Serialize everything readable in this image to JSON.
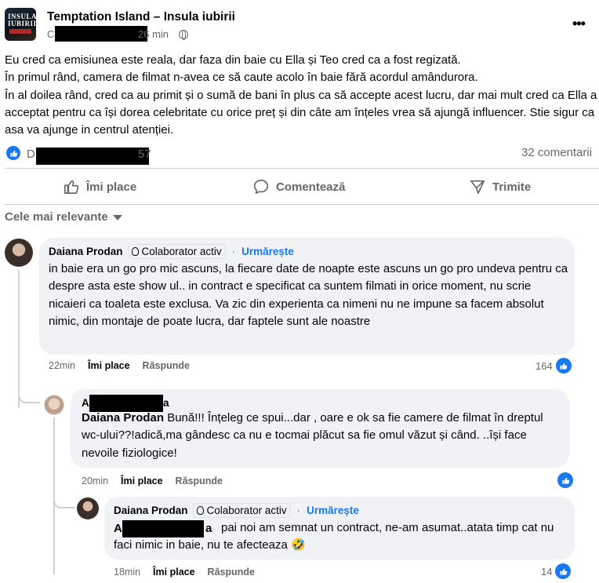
{
  "post": {
    "group_name": "Temptation Island – Insula iubirii",
    "group_logo_text": "INSULA IUBIRII",
    "author_partial": "Ch",
    "time_suffix": "26 min",
    "body": "Eu cred ca emisiunea este reala, dar faza din baie cu Ella și Teo cred ca a fost regizată.\nÎn primul rând, camera de filmat n-avea ce să caute acolo în baie fără acordul amândurora.\nÎn al doilea rând, cred ca au primit și o sumă de bani în plus ca să accepte acest lucru, dar mai mult cred ca Ella a acceptat pentru ca își dorea celebritate cu orice preț și din câte am înțeles vrea să ajungă influencer. Stie sigur ca asa va ajunge in centrul atenției.",
    "reactions_prefix": "D",
    "reactions_suffix": "57",
    "comments_count": "32 comentarii"
  },
  "actions": {
    "like": "Îmi place",
    "comment": "Comentează",
    "share": "Trimite"
  },
  "sort_label": "Cele mai relevante",
  "comments": [
    {
      "author": "Daiana Prodan",
      "badge": "Colaborator activ",
      "follow": "Urmărește",
      "text": "in baie era un go pro mic ascuns, la fiecare date de noapte este ascuns un go pro undeva pentru ca despre asta este show ul.. in contract e specificat ca suntem filmati in orice moment, nu scrie nicaieri ca toaleta este exclusa. Va zic din experienta ca nimeni nu ne impune sa facem absolut nimic, din montaje de poate lucra, dar faptele sunt ale noastre",
      "time": "22min",
      "like": "Îmi place",
      "reply": "Răspunde",
      "reactions": "164"
    },
    {
      "author_prefix": "A",
      "author_suffix": "a",
      "mention": "Daiana Prodan",
      "text": "Bună!!! Înțeleg ce spui...dar , oare e ok sa fie camere de filmat în dreptul wc-ului??!adică,ma gândesc ca nu e tocmai plăcut sa fie omul văzut și când. ..își face nevoile fiziologice!",
      "time": "20min",
      "like": "Îmi place",
      "reply": "Răspunde"
    },
    {
      "author": "Daiana Prodan",
      "badge": "Colaborator activ",
      "follow": "Urmărește",
      "mention_prefix": "A",
      "mention_suffix": "a",
      "text": "pai noi am semnat un contract, ne-am asumat..atata timp cat nu faci nimic in baie, nu te afecteaza",
      "emoji": "🤣",
      "time": "18min",
      "like": "Îmi place",
      "reply": "Răspunde",
      "reactions": "14"
    }
  ],
  "icons": {
    "more": "more-options-icon",
    "globe": "globe-icon",
    "like": "thumbs-up-icon",
    "comment": "speech-bubble-icon",
    "share": "send-icon",
    "award": "award-icon"
  },
  "colors": {
    "accent": "#1877f2",
    "secondary_text": "#65676b",
    "bubble": "#f0f2f5"
  }
}
